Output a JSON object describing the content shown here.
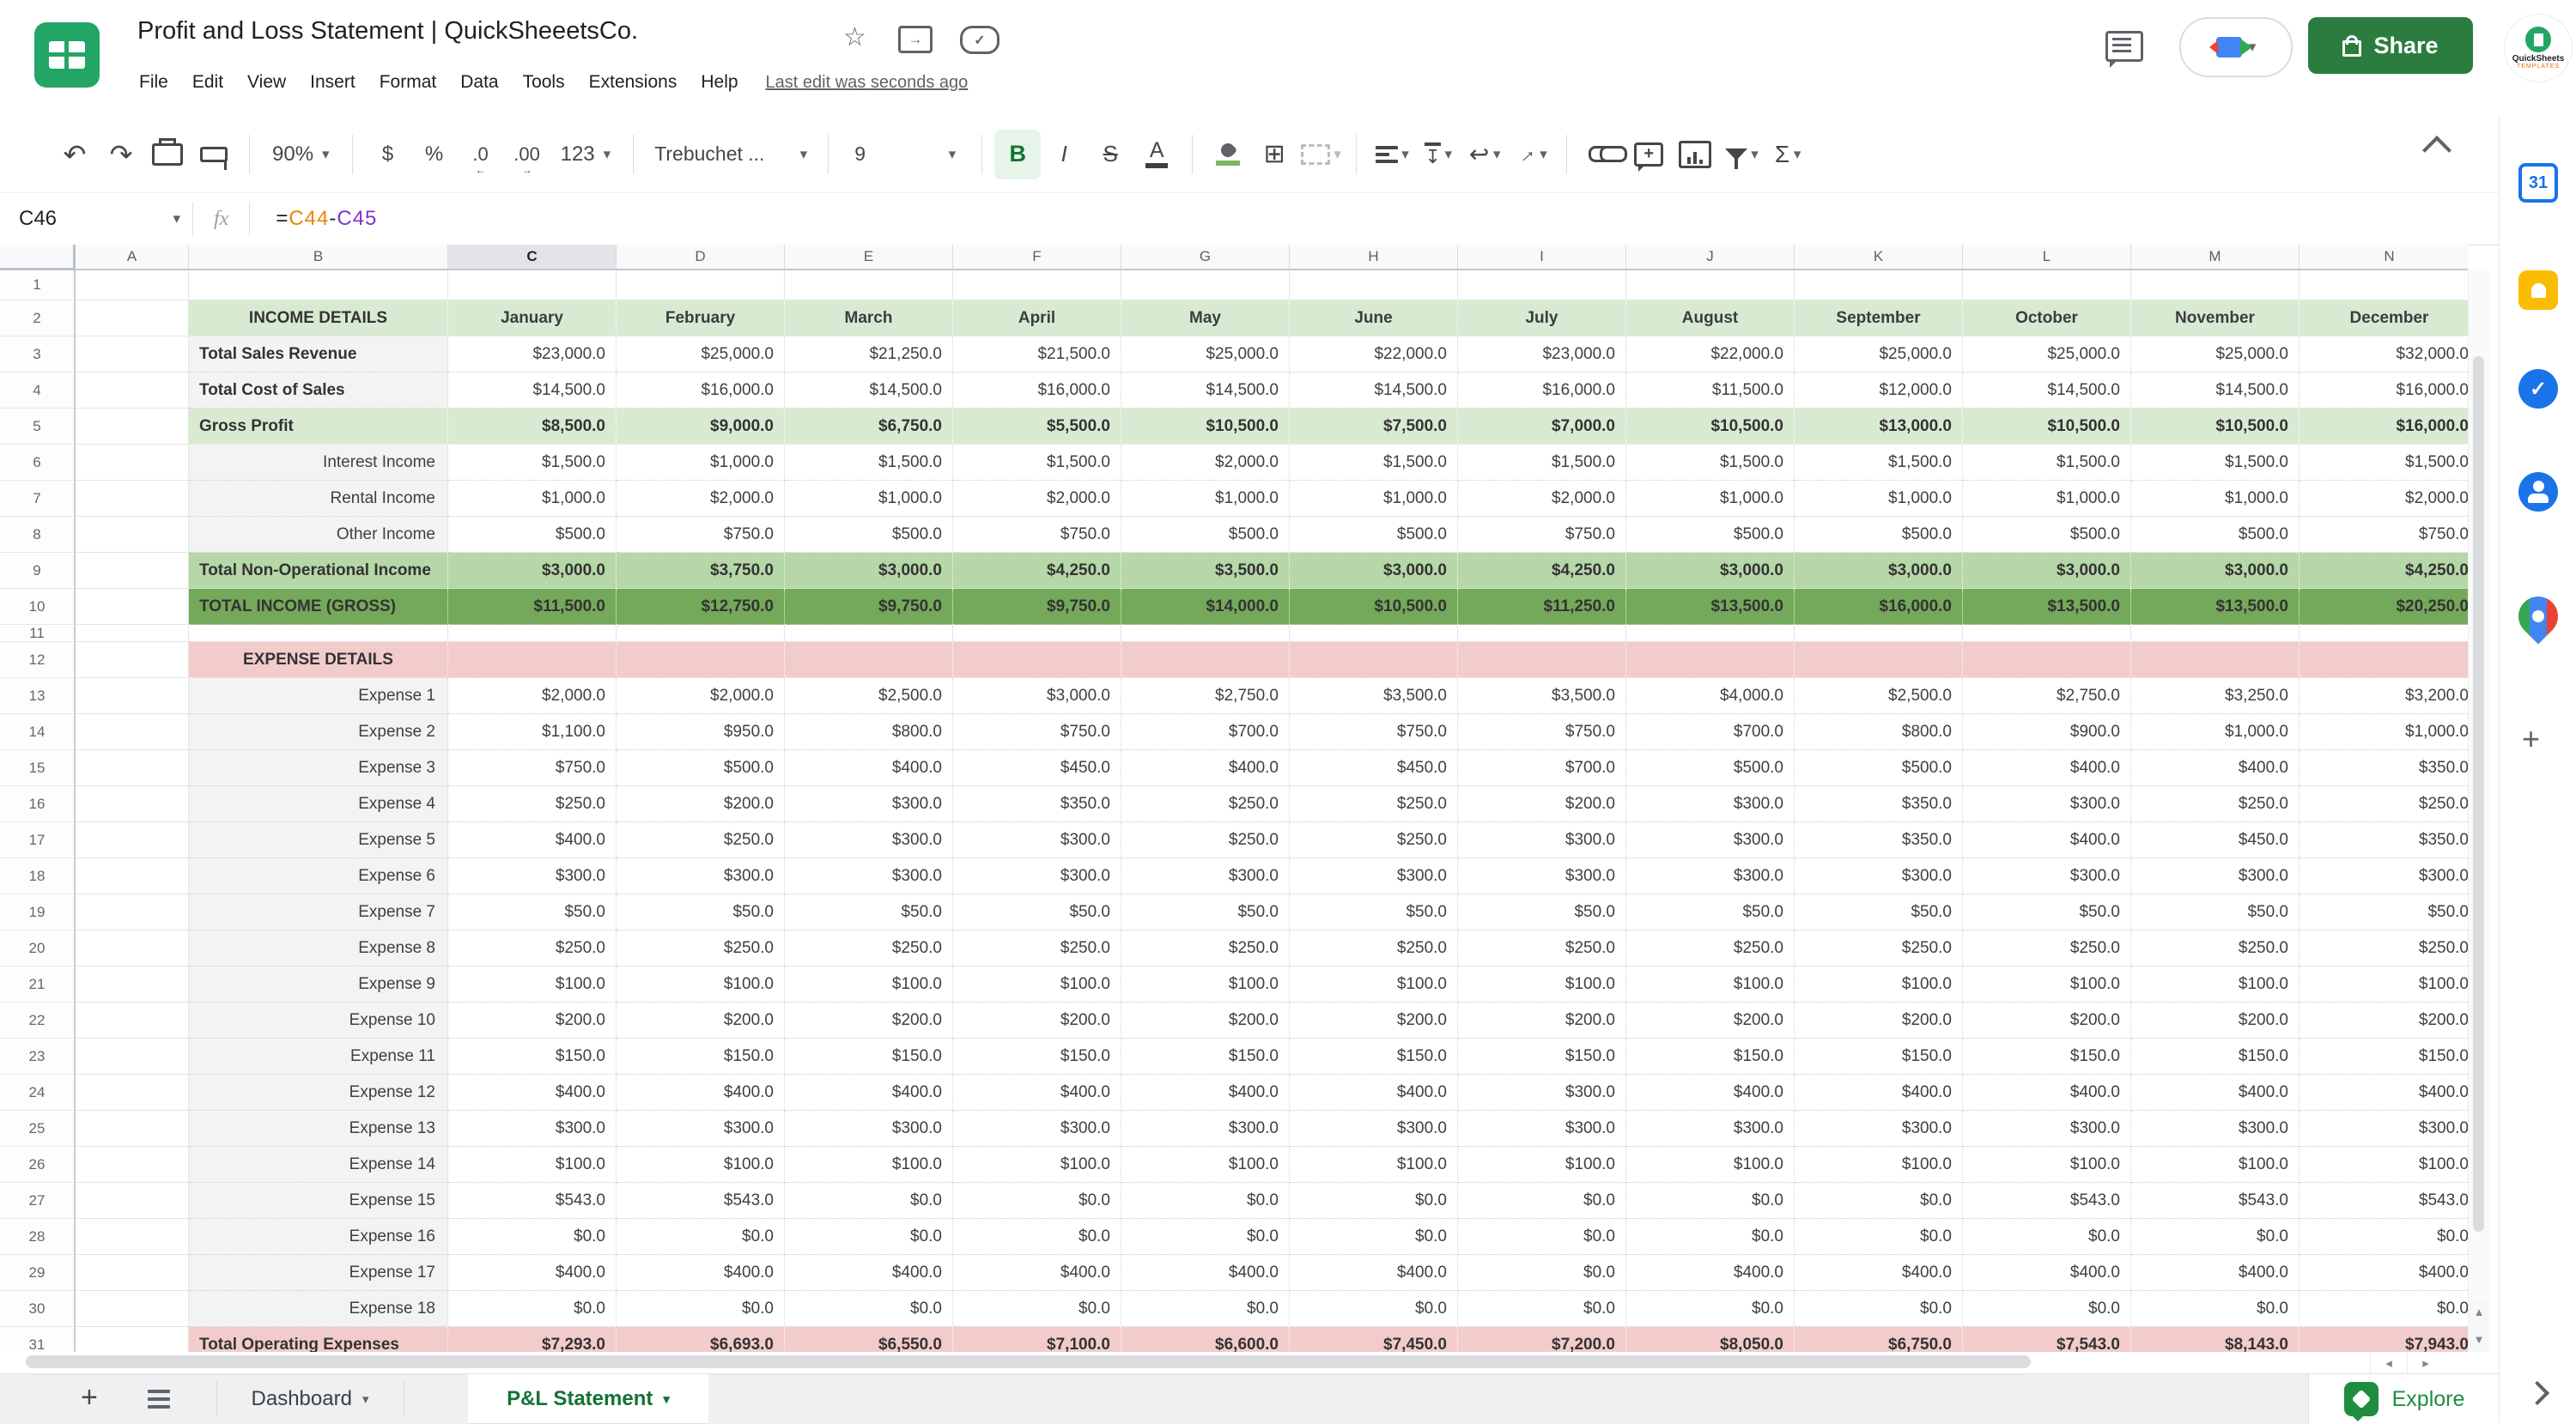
{
  "titlebar": {
    "title": "Profit and Loss Statement | QuickSheeetsCo.",
    "menus": [
      "File",
      "Edit",
      "View",
      "Insert",
      "Format",
      "Data",
      "Tools",
      "Extensions",
      "Help"
    ],
    "last_edit": "Last edit was seconds ago",
    "share_label": "Share",
    "avatar_line1": "QuickSheets",
    "avatar_line2": "TEMPLATES"
  },
  "toolbar": {
    "zoom": "90%",
    "currency": "$",
    "percent": "%",
    "dec_decrease": ".0",
    "dec_increase": ".00",
    "more_formats": "123",
    "font_name": "Trebuchet ...",
    "font_size": "9",
    "bold": "B",
    "italic": "I",
    "strike": "S",
    "text_color": "A",
    "sigma": "Σ"
  },
  "formula_bar": {
    "cell_ref": "C46",
    "fx": "fx",
    "formula_parts": [
      {
        "t": "=",
        "c": "#202124"
      },
      {
        "t": "C44",
        "c": "#ea8600"
      },
      {
        "t": "-",
        "c": "#202124"
      },
      {
        "t": "C45",
        "c": "#8430ce"
      }
    ]
  },
  "colors": {
    "header_green": "#d9ead3",
    "subtotal_green": "#b6d7a8",
    "total_green": "#74a85a",
    "pink": "#f2cccb",
    "share_green": "#2a7d3e",
    "active_tab_green": "#137333"
  },
  "sheet": {
    "col_letters": [
      "A",
      "B",
      "C",
      "D",
      "E",
      "F",
      "G",
      "H",
      "I",
      "J",
      "K",
      "L",
      "M",
      "N"
    ],
    "selected_col": "C",
    "months": [
      "January",
      "February",
      "March",
      "April",
      "May",
      "June",
      "July",
      "August",
      "September",
      "October",
      "November",
      "December"
    ],
    "rows": [
      {
        "n": 1,
        "kind": "blank",
        "h": 35
      },
      {
        "n": 2,
        "kind": "months",
        "bg": "g1",
        "label": "INCOME DETAILS"
      },
      {
        "n": 3,
        "kind": "data",
        "label": "Total Sales Revenue",
        "lab": "bold-left",
        "vals": [
          23000,
          25000,
          21250,
          21500,
          25000,
          22000,
          23000,
          22000,
          25000,
          25000,
          25000,
          32000
        ]
      },
      {
        "n": 4,
        "kind": "data",
        "label": "Total Cost of Sales",
        "lab": "bold-left",
        "vals": [
          14500,
          16000,
          14500,
          16000,
          14500,
          14500,
          16000,
          11500,
          12000,
          14500,
          14500,
          16000
        ]
      },
      {
        "n": 5,
        "kind": "data",
        "bg": "g1",
        "bold": true,
        "label": "Gross Profit",
        "lab": "bold-left",
        "vals": [
          8500,
          9000,
          6750,
          5500,
          10500,
          7500,
          7000,
          10500,
          13000,
          10500,
          10500,
          16000
        ]
      },
      {
        "n": 6,
        "kind": "data",
        "label": "Interest Income",
        "lab": "right",
        "vals": [
          1500,
          1000,
          1500,
          1500,
          2000,
          1500,
          1500,
          1500,
          1500,
          1500,
          1500,
          1500
        ]
      },
      {
        "n": 7,
        "kind": "data",
        "label": "Rental Income",
        "lab": "right",
        "vals": [
          1000,
          2000,
          1000,
          2000,
          1000,
          1000,
          2000,
          1000,
          1000,
          1000,
          1000,
          2000
        ]
      },
      {
        "n": 8,
        "kind": "data",
        "label": "Other Income",
        "lab": "right",
        "vals": [
          500,
          750,
          500,
          750,
          500,
          500,
          750,
          500,
          500,
          500,
          500,
          750
        ]
      },
      {
        "n": 9,
        "kind": "data",
        "bg": "g2",
        "bold": true,
        "label": "Total Non-Operational Income",
        "lab": "bold-left",
        "vals": [
          3000,
          3750,
          3000,
          4250,
          3500,
          3000,
          4250,
          3000,
          3000,
          3000,
          3000,
          4250
        ]
      },
      {
        "n": 10,
        "kind": "data",
        "bg": "g3",
        "bold": true,
        "label": "TOTAL INCOME (GROSS)",
        "lab": "bold-left",
        "vals": [
          11500,
          12750,
          9750,
          9750,
          14000,
          10500,
          11250,
          13500,
          16000,
          13500,
          13500,
          20250
        ]
      },
      {
        "n": 11,
        "kind": "blank",
        "h": 20
      },
      {
        "n": 12,
        "kind": "section",
        "bg": "pk",
        "label": "EXPENSE DETAILS"
      },
      {
        "n": 13,
        "kind": "data",
        "label": "Expense 1",
        "lab": "right",
        "vals": [
          2000,
          2000,
          2500,
          3000,
          2750,
          3500,
          3500,
          4000,
          2500,
          2750,
          3250,
          3200
        ]
      },
      {
        "n": 14,
        "kind": "data",
        "label": "Expense 2",
        "lab": "right",
        "vals": [
          1100,
          950,
          800,
          750,
          700,
          750,
          750,
          700,
          800,
          900,
          1000,
          1000
        ]
      },
      {
        "n": 15,
        "kind": "data",
        "label": "Expense 3",
        "lab": "right",
        "vals": [
          750,
          500,
          400,
          450,
          400,
          450,
          700,
          500,
          500,
          400,
          400,
          350
        ]
      },
      {
        "n": 16,
        "kind": "data",
        "label": "Expense 4",
        "lab": "right",
        "vals": [
          250,
          200,
          300,
          350,
          250,
          250,
          200,
          300,
          350,
          300,
          250,
          250
        ]
      },
      {
        "n": 17,
        "kind": "data",
        "label": "Expense 5",
        "lab": "right",
        "vals": [
          400,
          250,
          300,
          300,
          250,
          250,
          300,
          300,
          350,
          400,
          450,
          350
        ]
      },
      {
        "n": 18,
        "kind": "data",
        "label": "Expense 6",
        "lab": "right",
        "vals": [
          300,
          300,
          300,
          300,
          300,
          300,
          300,
          300,
          300,
          300,
          300,
          300
        ]
      },
      {
        "n": 19,
        "kind": "data",
        "label": "Expense 7",
        "lab": "right",
        "vals": [
          50,
          50,
          50,
          50,
          50,
          50,
          50,
          50,
          50,
          50,
          50,
          50
        ]
      },
      {
        "n": 20,
        "kind": "data",
        "label": "Expense 8",
        "lab": "right",
        "vals": [
          250,
          250,
          250,
          250,
          250,
          250,
          250,
          250,
          250,
          250,
          250,
          250
        ]
      },
      {
        "n": 21,
        "kind": "data",
        "label": "Expense 9",
        "lab": "right",
        "vals": [
          100,
          100,
          100,
          100,
          100,
          100,
          100,
          100,
          100,
          100,
          100,
          100
        ]
      },
      {
        "n": 22,
        "kind": "data",
        "label": "Expense 10",
        "lab": "right",
        "vals": [
          200,
          200,
          200,
          200,
          200,
          200,
          200,
          200,
          200,
          200,
          200,
          200
        ]
      },
      {
        "n": 23,
        "kind": "data",
        "label": "Expense 11",
        "lab": "right",
        "vals": [
          150,
          150,
          150,
          150,
          150,
          150,
          150,
          150,
          150,
          150,
          150,
          150
        ]
      },
      {
        "n": 24,
        "kind": "data",
        "label": "Expense 12",
        "lab": "right",
        "vals": [
          400,
          400,
          400,
          400,
          400,
          400,
          300,
          400,
          400,
          400,
          400,
          400
        ]
      },
      {
        "n": 25,
        "kind": "data",
        "label": "Expense 13",
        "lab": "right",
        "vals": [
          300,
          300,
          300,
          300,
          300,
          300,
          300,
          300,
          300,
          300,
          300,
          300
        ]
      },
      {
        "n": 26,
        "kind": "data",
        "label": "Expense 14",
        "lab": "right",
        "vals": [
          100,
          100,
          100,
          100,
          100,
          100,
          100,
          100,
          100,
          100,
          100,
          100
        ]
      },
      {
        "n": 27,
        "kind": "data",
        "label": "Expense 15",
        "lab": "right",
        "vals": [
          543,
          543,
          0,
          0,
          0,
          0,
          0,
          0,
          0,
          543,
          543,
          543
        ]
      },
      {
        "n": 28,
        "kind": "data",
        "label": "Expense 16",
        "lab": "right",
        "vals": [
          0,
          0,
          0,
          0,
          0,
          0,
          0,
          0,
          0,
          0,
          0,
          0
        ]
      },
      {
        "n": 29,
        "kind": "data",
        "label": "Expense 17",
        "lab": "right",
        "vals": [
          400,
          400,
          400,
          400,
          400,
          400,
          0,
          400,
          400,
          400,
          400,
          400
        ]
      },
      {
        "n": 30,
        "kind": "data",
        "label": "Expense 18",
        "lab": "right",
        "vals": [
          0,
          0,
          0,
          0,
          0,
          0,
          0,
          0,
          0,
          0,
          0,
          0
        ]
      },
      {
        "n": 31,
        "kind": "data",
        "bg": "pk",
        "bold": true,
        "label": "Total Operating Expenses",
        "lab": "bold-left",
        "vals": [
          7293,
          6693,
          6550,
          7100,
          6600,
          7450,
          7200,
          8050,
          6750,
          7543,
          8143,
          7943
        ]
      }
    ]
  },
  "tabs": {
    "add": "+",
    "items": [
      {
        "label": "Dashboard",
        "active": false
      },
      {
        "label": "P&L Statement",
        "active": true
      }
    ],
    "explore_label": "Explore"
  }
}
